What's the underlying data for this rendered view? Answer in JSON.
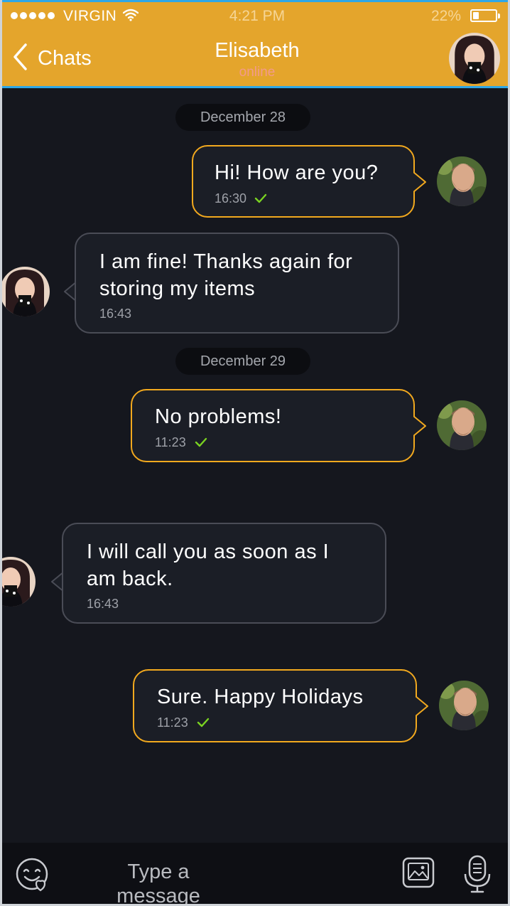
{
  "status_bar": {
    "carrier": "VIRGIN",
    "time": "4:21 PM",
    "battery": "22%",
    "battery_level": 0.22
  },
  "header": {
    "back_label": "Chats",
    "contact_name": "Elisabeth",
    "contact_status": "online"
  },
  "dates": [
    "December 28",
    "December 29"
  ],
  "messages": [
    {
      "text": "Hi! How are you?",
      "time": "16:30",
      "direction": "out",
      "read": true
    },
    {
      "text": "I am fine! Thanks again for storing my items",
      "time": "16:43",
      "direction": "in"
    },
    {
      "text": "No problems!",
      "time": "11:23",
      "direction": "out",
      "read": true
    },
    {
      "text": "I will call you as soon as I am back.",
      "time": "16:43",
      "direction": "in"
    },
    {
      "text": "Sure. Happy Holidays",
      "time": "11:23",
      "direction": "out",
      "read": true
    }
  ],
  "composer": {
    "placeholder": "Type a message",
    "icons": [
      "emoji-icon",
      "image-icon",
      "microphone-icon"
    ]
  },
  "colors": {
    "header": "#e4a52c",
    "header_border": "#2fa7e6",
    "background": "#15171e",
    "outgoing_border": "#f2a91e",
    "incoming_border": "#4a4c56",
    "checkmark": "#7ad321",
    "online": "#f39a8a"
  }
}
